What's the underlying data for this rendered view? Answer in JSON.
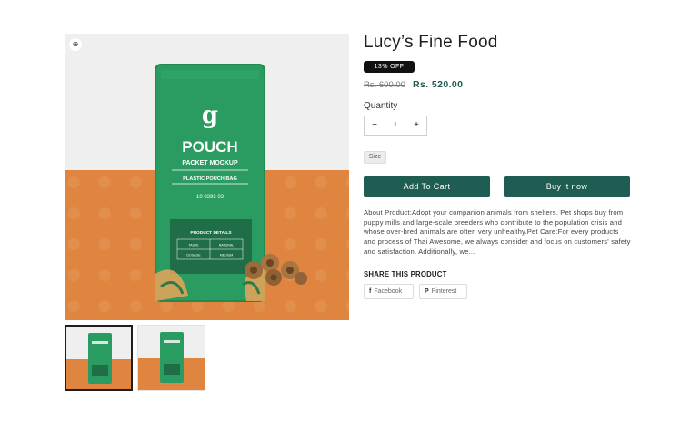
{
  "product": {
    "title": "Lucy’s Fine Food",
    "discount_badge": "13% OFF",
    "price_original": "Rs. 600.00",
    "price_sale": "Rs. 520.00",
    "quantity_label": "Quantity",
    "quantity_value": "1",
    "quantity_minus": "−",
    "quantity_plus": "+",
    "size_option": "Size",
    "add_to_cart_label": "Add To Cart",
    "buy_now_label": "Buy it now",
    "description": "About Product:Adopt your companion animals from shelters. Pet shops buy from puppy mills and large-scale breeders who contribute to the population crisis and whose over-bred animals are often very unhealthy.Pet Care:For every products and process of Thai Awesome, we always consider and focus on customers' safety and satisfaction. Additionally, we..."
  },
  "packaging": {
    "logo_letter": "g",
    "line1": "POUCH",
    "line2": "PACKET MOCKUP",
    "line3": "PLASTIC POUCH BAG",
    "code": "10 0392 03",
    "details_title": "PRODUCT DETAILS",
    "details_r1c1": "TASTE",
    "details_r1c2": "NATURAL",
    "details_r2c1": "DOSAGE",
    "details_r2c2": "MEDIUM"
  },
  "share": {
    "title": "SHARE THIS PRODUCT",
    "facebook_label": "Facebook",
    "pinterest_label": "Pinterest",
    "facebook_icon": "f",
    "pinterest_icon": "P"
  },
  "gallery": {
    "zoom_icon": "⊕"
  },
  "colors": {
    "brand": "#1f5c52",
    "pouch_green": "#2a9b61",
    "background_orange": "#e0853f"
  }
}
